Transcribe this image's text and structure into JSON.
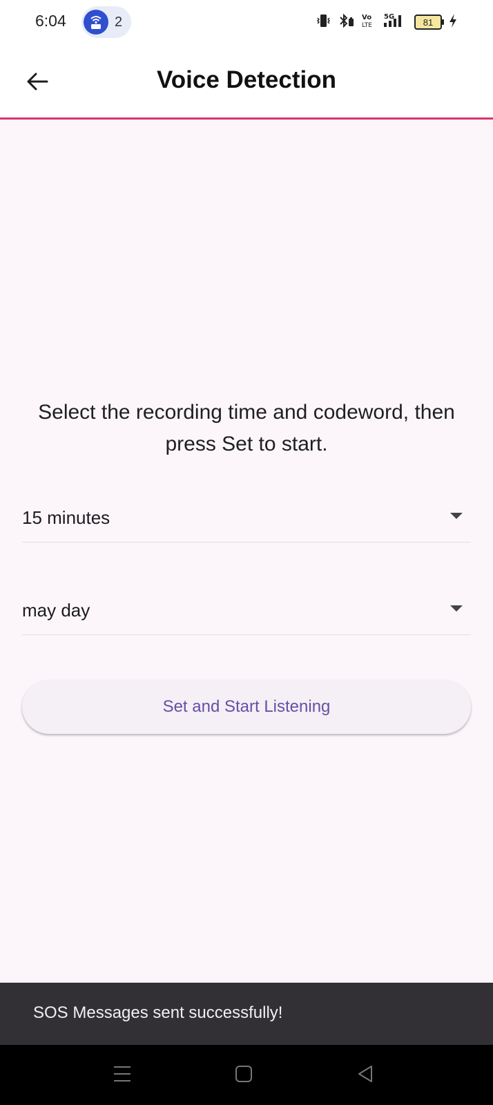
{
  "status_bar": {
    "time": "6:04",
    "hotspot_count": "2",
    "battery_level": "81",
    "icons": [
      "hotspot-icon",
      "vibrate-icon",
      "bluetooth-icon",
      "volte-icon",
      "signal-5g-icon",
      "battery-icon",
      "charging-icon"
    ]
  },
  "app_bar": {
    "title": "Voice Detection",
    "accent_color": "#d7336b"
  },
  "main": {
    "instructions": "Select the recording time and codeword, then press Set to start.",
    "time_select": {
      "selected": "15 minutes"
    },
    "codeword_select": {
      "selected": "may day"
    },
    "start_button_label": "Set and Start Listening",
    "button_text_color": "#6650a4"
  },
  "snackbar": {
    "message": "SOS Messages sent successfully!"
  },
  "nav_bar": {
    "icons": [
      "recents-icon",
      "home-icon",
      "back-nav-icon"
    ]
  }
}
